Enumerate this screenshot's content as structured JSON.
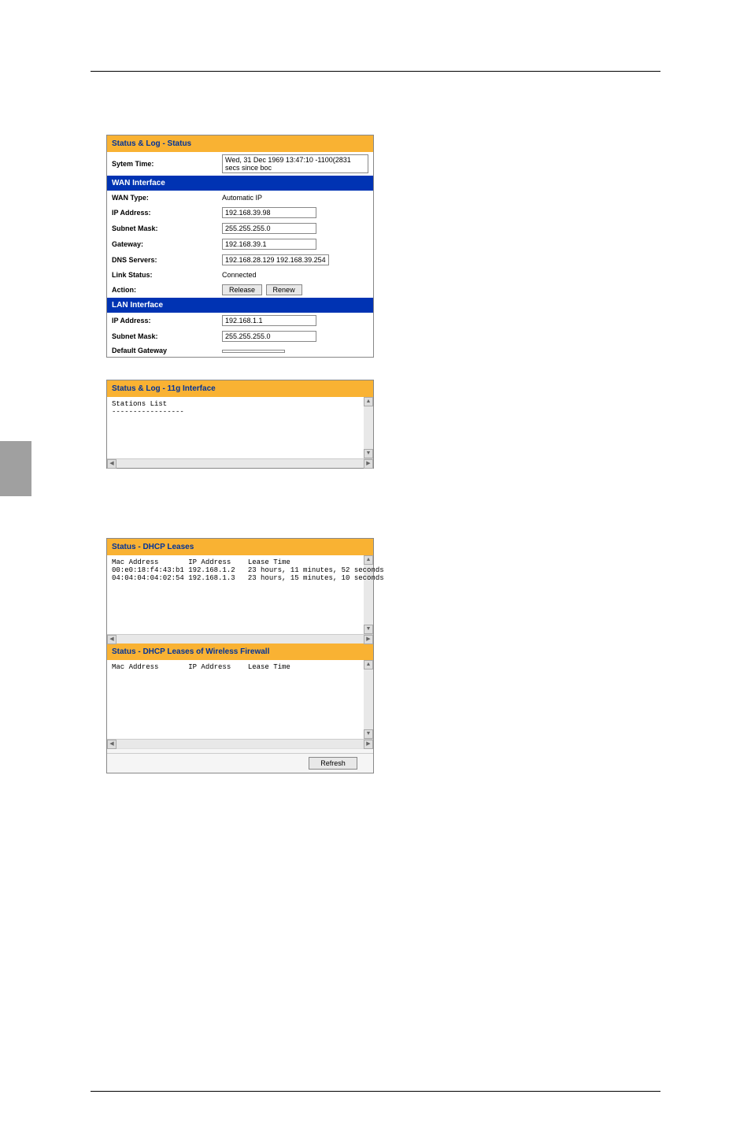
{
  "panel1": {
    "title": "Status & Log - Status",
    "system_time_label": "Sytem Time:",
    "system_time_value": "Wed, 31 Dec 1969 13:47:10 -1100(2831 secs since boc",
    "wan_header": "WAN Interface",
    "wan_type_label": "WAN Type:",
    "wan_type_value": "Automatic IP",
    "wan_ip_label": "IP Address:",
    "wan_ip_value": "192.168.39.98",
    "wan_subnet_label": "Subnet Mask:",
    "wan_subnet_value": "255.255.255.0",
    "gateway_label": "Gateway:",
    "gateway_value": "192.168.39.1",
    "dns_label": "DNS Servers:",
    "dns_value": "192.168.28.129 192.168.39.254",
    "link_label": "Link Status:",
    "link_value": "Connected",
    "action_label": "Action:",
    "release_btn": "Release",
    "renew_btn": "Renew",
    "lan_header": "LAN Interface",
    "lan_ip_label": "IP Address:",
    "lan_ip_value": "192.168.1.1",
    "lan_subnet_label": "Subnet Mask:",
    "lan_subnet_value": "255.255.255.0",
    "default_gw_label": "Default Gateway",
    "default_gw_value": ""
  },
  "panel2": {
    "title": "Status & Log - 11g Interface",
    "content_line1": "Stations List",
    "content_line2": "-----------------"
  },
  "panel3": {
    "title1": "Status - DHCP Leases",
    "header_line": "Mac Address       IP Address    Lease Time",
    "row1": "00:e0:18:f4:43:b1 192.168.1.2   23 hours, 11 minutes, 52 seconds",
    "row2": "04:04:04:04:02:54 192.168.1.3   23 hours, 15 minutes, 10 seconds",
    "title2": "Status - DHCP Leases of Wireless Firewall",
    "header_line2": "Mac Address       IP Address    Lease Time",
    "refresh_btn": "Refresh"
  }
}
